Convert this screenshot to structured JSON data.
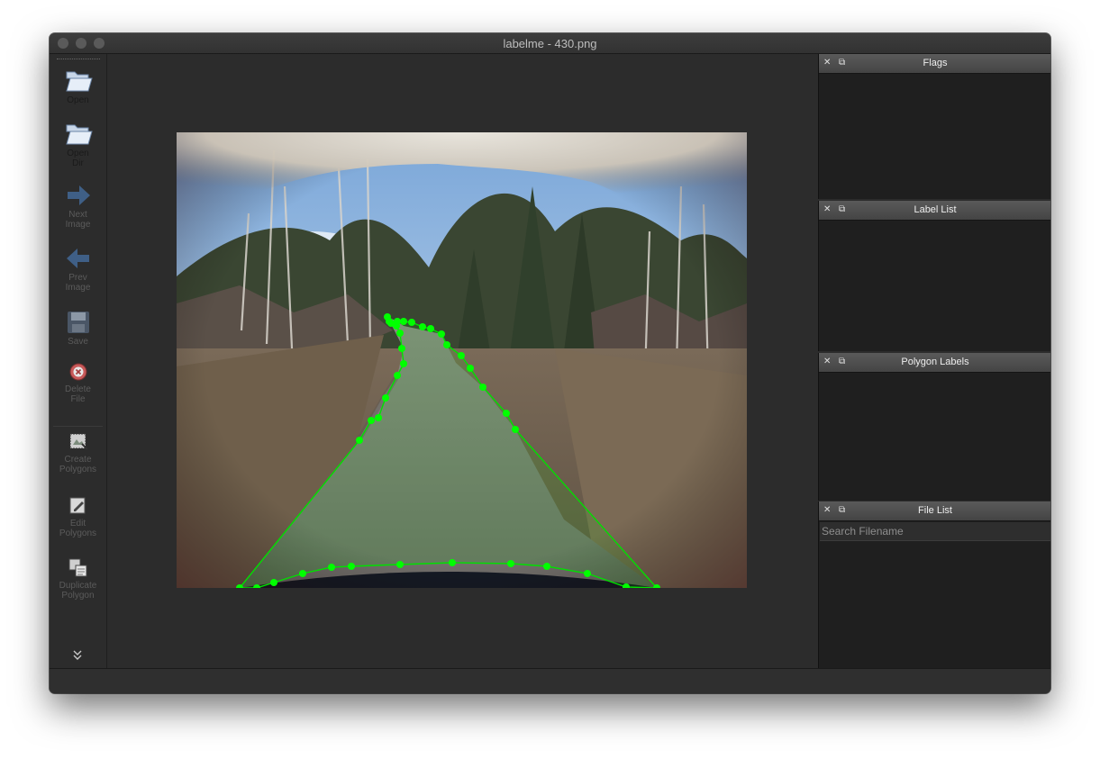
{
  "window": {
    "title": "labelme - 430.png"
  },
  "toolbar": {
    "items": [
      {
        "label": "Open",
        "icon": "folder-open-icon",
        "enabled": true
      },
      {
        "label": "Open\nDir",
        "icon": "folder-open-icon",
        "enabled": true
      },
      {
        "label": "Next\nImage",
        "icon": "arrow-right-icon",
        "enabled": false
      },
      {
        "label": "Prev\nImage",
        "icon": "arrow-left-icon",
        "enabled": false
      },
      {
        "label": "Save",
        "icon": "floppy-disk-icon",
        "enabled": false
      },
      {
        "label": "Delete\nFile",
        "icon": "delete-icon",
        "enabled": false
      },
      {
        "label": "Create\nPolygons",
        "icon": "create-polygon-icon",
        "enabled": false
      },
      {
        "label": "Edit\nPolygons",
        "icon": "edit-polygon-icon",
        "enabled": false
      },
      {
        "label": "Duplicate\nPolygon",
        "icon": "duplicate-polygon-icon",
        "enabled": false
      }
    ],
    "more_icon": "chevron-double-down-icon"
  },
  "docks": {
    "flags": {
      "title": "Flags"
    },
    "label_list": {
      "title": "Label List"
    },
    "polygon_labels": {
      "title": "Polygon Labels"
    },
    "file_list": {
      "title": "File List",
      "search_placeholder": "Search Filename"
    }
  },
  "colors": {
    "polygon": "#00e000",
    "background": "#2c2c2c",
    "panel": "#1f1f1f"
  }
}
